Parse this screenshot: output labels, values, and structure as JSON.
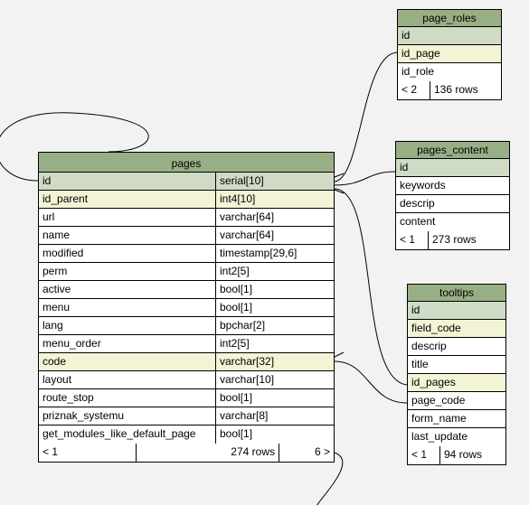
{
  "tables": {
    "pages": {
      "title": "pages",
      "columns": [
        {
          "name": "id",
          "type": "serial[10]",
          "pk": true
        },
        {
          "name": "id_parent",
          "type": "int4[10]",
          "hl": true
        },
        {
          "name": "url",
          "type": "varchar[64]"
        },
        {
          "name": "name",
          "type": "varchar[64]"
        },
        {
          "name": "modified",
          "type": "timestamp[29,6]"
        },
        {
          "name": "perm",
          "type": "int2[5]"
        },
        {
          "name": "active",
          "type": "bool[1]"
        },
        {
          "name": "menu",
          "type": "bool[1]"
        },
        {
          "name": "lang",
          "type": "bpchar[2]"
        },
        {
          "name": "menu_order",
          "type": "int2[5]"
        },
        {
          "name": "code",
          "type": "varchar[32]",
          "hl": true
        },
        {
          "name": "layout",
          "type": "varchar[10]"
        },
        {
          "name": "route_stop",
          "type": "bool[1]"
        },
        {
          "name": "priznak_systemu",
          "type": "varchar[8]"
        },
        {
          "name": "get_modules_like_default_page",
          "type": "bool[1]"
        }
      ],
      "footer": {
        "prev": "< 1",
        "rows": "274 rows",
        "next": "6 >"
      }
    },
    "page_roles": {
      "title": "page_roles",
      "columns": [
        {
          "name": "id",
          "pk": true
        },
        {
          "name": "id_page",
          "hl": true
        },
        {
          "name": "id_role"
        }
      ],
      "footer": {
        "a": "< 2",
        "b": "136 rows"
      }
    },
    "pages_content": {
      "title": "pages_content",
      "columns": [
        {
          "name": "id",
          "pk": true
        },
        {
          "name": "keywords"
        },
        {
          "name": "descrip"
        },
        {
          "name": "content"
        }
      ],
      "footer": {
        "a": "< 1",
        "b": "273 rows"
      }
    },
    "tooltips": {
      "title": "tooltips",
      "columns": [
        {
          "name": "id",
          "pk": true
        },
        {
          "name": "field_code",
          "hl": true
        },
        {
          "name": "descrip"
        },
        {
          "name": "title"
        },
        {
          "name": "id_pages",
          "hl": true
        },
        {
          "name": "page_code"
        },
        {
          "name": "form_name"
        },
        {
          "name": "last_update"
        }
      ],
      "footer": {
        "a": "< 1",
        "b": "94 rows"
      }
    }
  }
}
